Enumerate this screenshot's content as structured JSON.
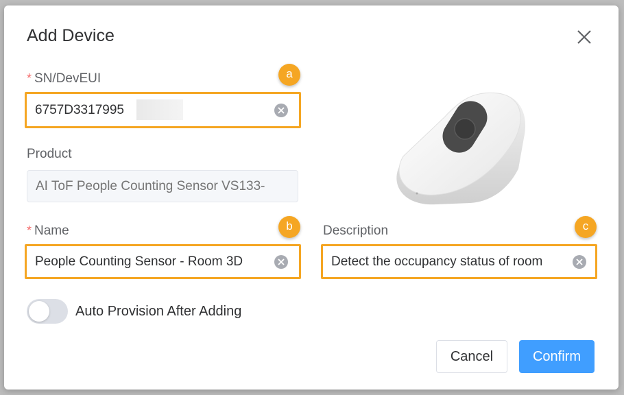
{
  "dialog": {
    "title": "Add Device"
  },
  "form": {
    "sn": {
      "label": "SN/DevEUI",
      "value": "6757D3317995",
      "required_mark": "*",
      "callout": "a"
    },
    "product": {
      "label": "Product",
      "placeholder": "AI ToF People Counting Sensor VS133-"
    },
    "name": {
      "label": "Name",
      "value": "People Counting Sensor - Room 3D",
      "required_mark": "*",
      "callout": "b"
    },
    "description": {
      "label": "Description",
      "value": "Detect the occupancy status of room",
      "callout": "c"
    },
    "auto_provision": {
      "label": "Auto Provision After Adding",
      "enabled": false
    }
  },
  "buttons": {
    "cancel": "Cancel",
    "confirm": "Confirm"
  },
  "colors": {
    "highlight": "#f5a623",
    "primary": "#409eff",
    "required": "#f56c6c"
  },
  "icons": {
    "close": "close-icon",
    "clear": "clear-circle-icon"
  }
}
